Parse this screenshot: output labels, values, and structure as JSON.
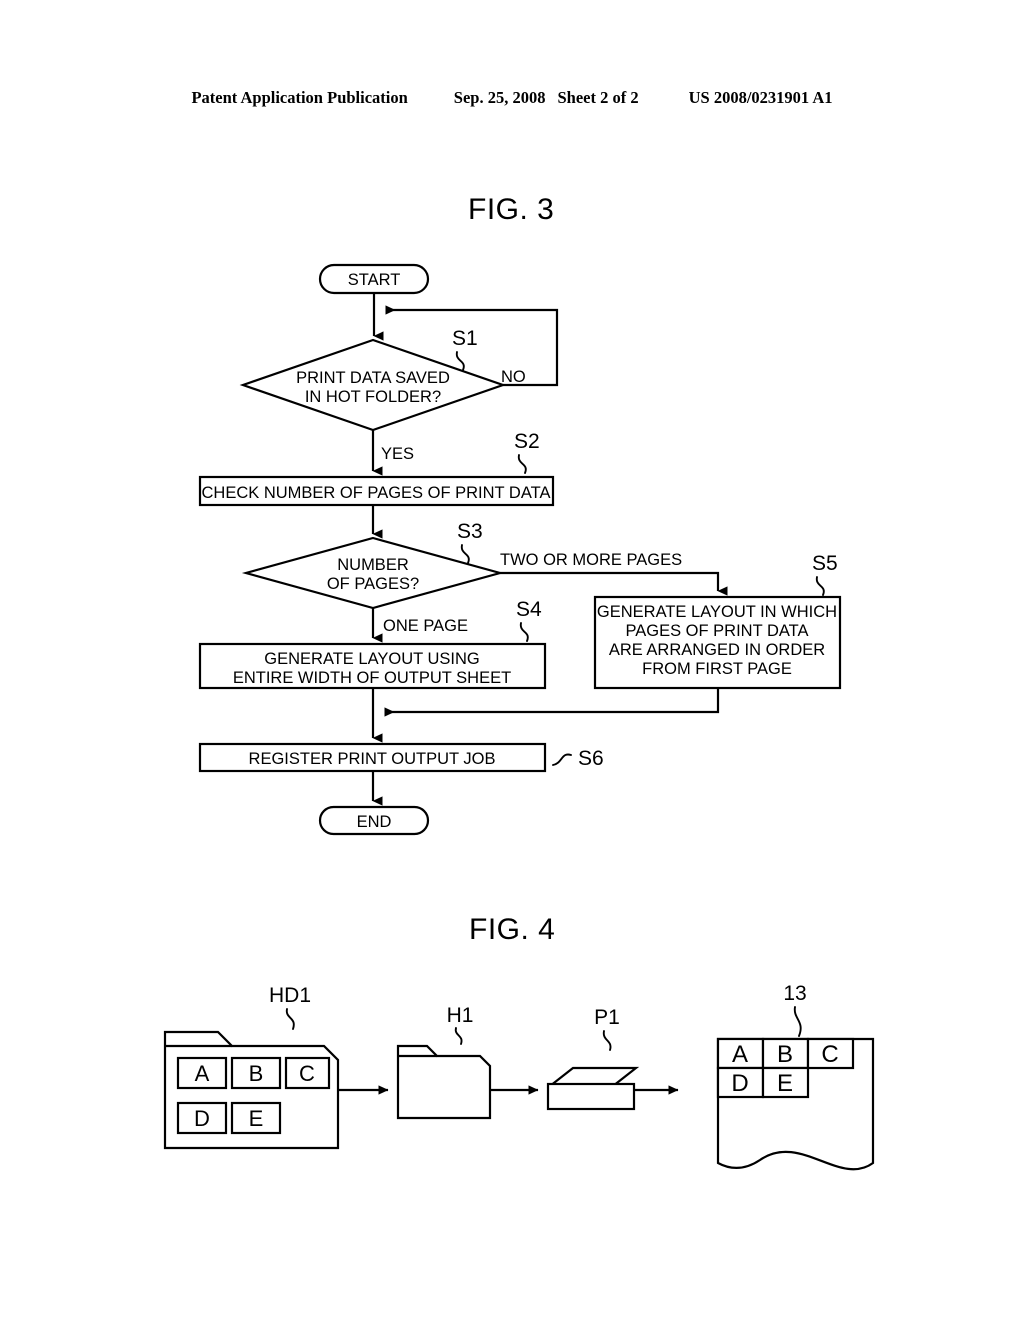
{
  "header": {
    "publication": "Patent Application Publication",
    "date": "Sep. 25, 2008",
    "sheet": "Sheet 2 of 2",
    "number": "US 2008/0231901 A1"
  },
  "figures": [
    {
      "id": "fig3",
      "title": "FIG. 3"
    },
    {
      "id": "fig4",
      "title": "FIG. 4"
    }
  ],
  "fig3": {
    "title": "FIG. 3",
    "start_label": "START",
    "end_label": "END",
    "nodes": {
      "s1": {
        "step": "S1",
        "type": "decision",
        "line1": "PRINT DATA SAVED",
        "line2": "IN HOT FOLDER?",
        "branch_yes": "YES",
        "branch_no": "NO"
      },
      "s2": {
        "step": "S2",
        "type": "process",
        "line1": "CHECK NUMBER OF PAGES OF PRINT DATA"
      },
      "s3": {
        "step": "S3",
        "type": "decision",
        "line1": "NUMBER",
        "line2": "OF PAGES?",
        "branch_one": "ONE PAGE",
        "branch_many": "TWO OR MORE PAGES"
      },
      "s4": {
        "step": "S4",
        "type": "process",
        "line1": "GENERATE LAYOUT USING",
        "line2": "ENTIRE WIDTH OF OUTPUT SHEET"
      },
      "s5": {
        "step": "S5",
        "type": "process",
        "line1": "GENERATE LAYOUT IN WHICH",
        "line2": "PAGES OF PRINT DATA",
        "line3": "ARE ARRANGED IN ORDER",
        "line4": "FROM FIRST PAGE"
      },
      "s6": {
        "step": "S6",
        "type": "process",
        "line1": "REGISTER PRINT OUTPUT JOB"
      }
    }
  },
  "fig4": {
    "title": "FIG. 4",
    "hot_folder": {
      "ref": "HD1",
      "name": "hot-folder-with-files",
      "row1": [
        "A",
        "B",
        "C"
      ],
      "row2": [
        "D",
        "E"
      ]
    },
    "folder": {
      "ref": "H1",
      "name": "folder"
    },
    "printer": {
      "ref": "P1",
      "name": "printer"
    },
    "output_sheet": {
      "ref": "13",
      "name": "output-sheet",
      "row1": [
        "A",
        "B",
        "C"
      ],
      "row2": [
        "D",
        "E"
      ]
    }
  },
  "colors": {
    "ink": "#000000",
    "paper": "#ffffff"
  }
}
